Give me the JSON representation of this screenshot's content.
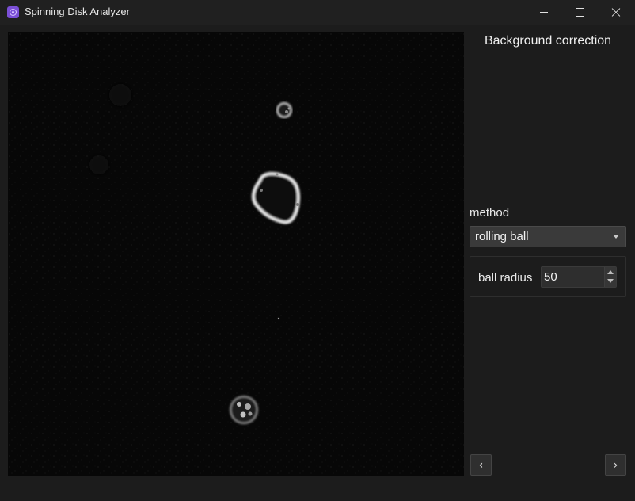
{
  "window": {
    "title": "Spinning Disk Analyzer",
    "icon": "app-icon",
    "controls": [
      "minimize-icon",
      "maximize-icon",
      "close-icon"
    ]
  },
  "panel": {
    "title": "Background correction",
    "method_label": "method",
    "method_value": "rolling ball",
    "param_label": "ball radius",
    "param_value": "50"
  },
  "nav": {
    "prev_label": "‹",
    "next_label": "›"
  },
  "colors": {
    "background": "#1c1c1c",
    "titlebar": "#202020",
    "image_bg": "#060606",
    "accent_icon": "#7b4fd6"
  }
}
